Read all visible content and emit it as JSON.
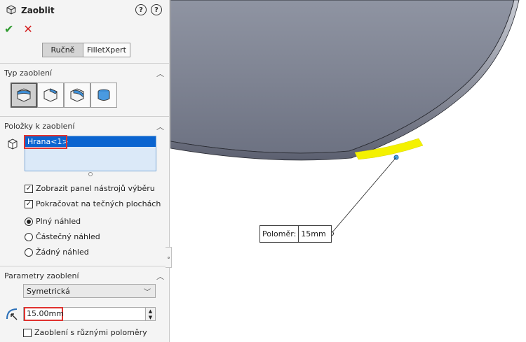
{
  "panel": {
    "title": "Zaoblit",
    "mode_tabs": [
      "Ručně",
      "FilletXpert"
    ],
    "sections": {
      "type": {
        "title": "Typ zaoblení"
      },
      "items": {
        "title": "Položky k zaoblení",
        "selected_item": "Hrana<1>",
        "options": [
          {
            "label": "Zobrazit panel nástrojů výběru",
            "checked": true
          },
          {
            "label": "Pokračovat na tečných plochách",
            "checked": true
          }
        ],
        "preview": [
          {
            "label": "Plný náhled",
            "selected": true
          },
          {
            "label": "Částečný náhled",
            "selected": false
          },
          {
            "label": "Žádný náhled",
            "selected": false
          }
        ]
      },
      "params": {
        "title": "Parametry zaoblení",
        "method": "Symetrická",
        "radius": "15.00mm",
        "multi_radius_label": "Zaoblení s různými poloměry"
      }
    }
  },
  "viewport": {
    "callout": {
      "label": "Poloměr:",
      "value": "15mm"
    }
  },
  "colors": {
    "selection": "#0a64d0",
    "highlight": "#e0322f",
    "edge_preview": "#f4f100",
    "ok": "#2e9a2e",
    "cancel": "#d42020"
  }
}
